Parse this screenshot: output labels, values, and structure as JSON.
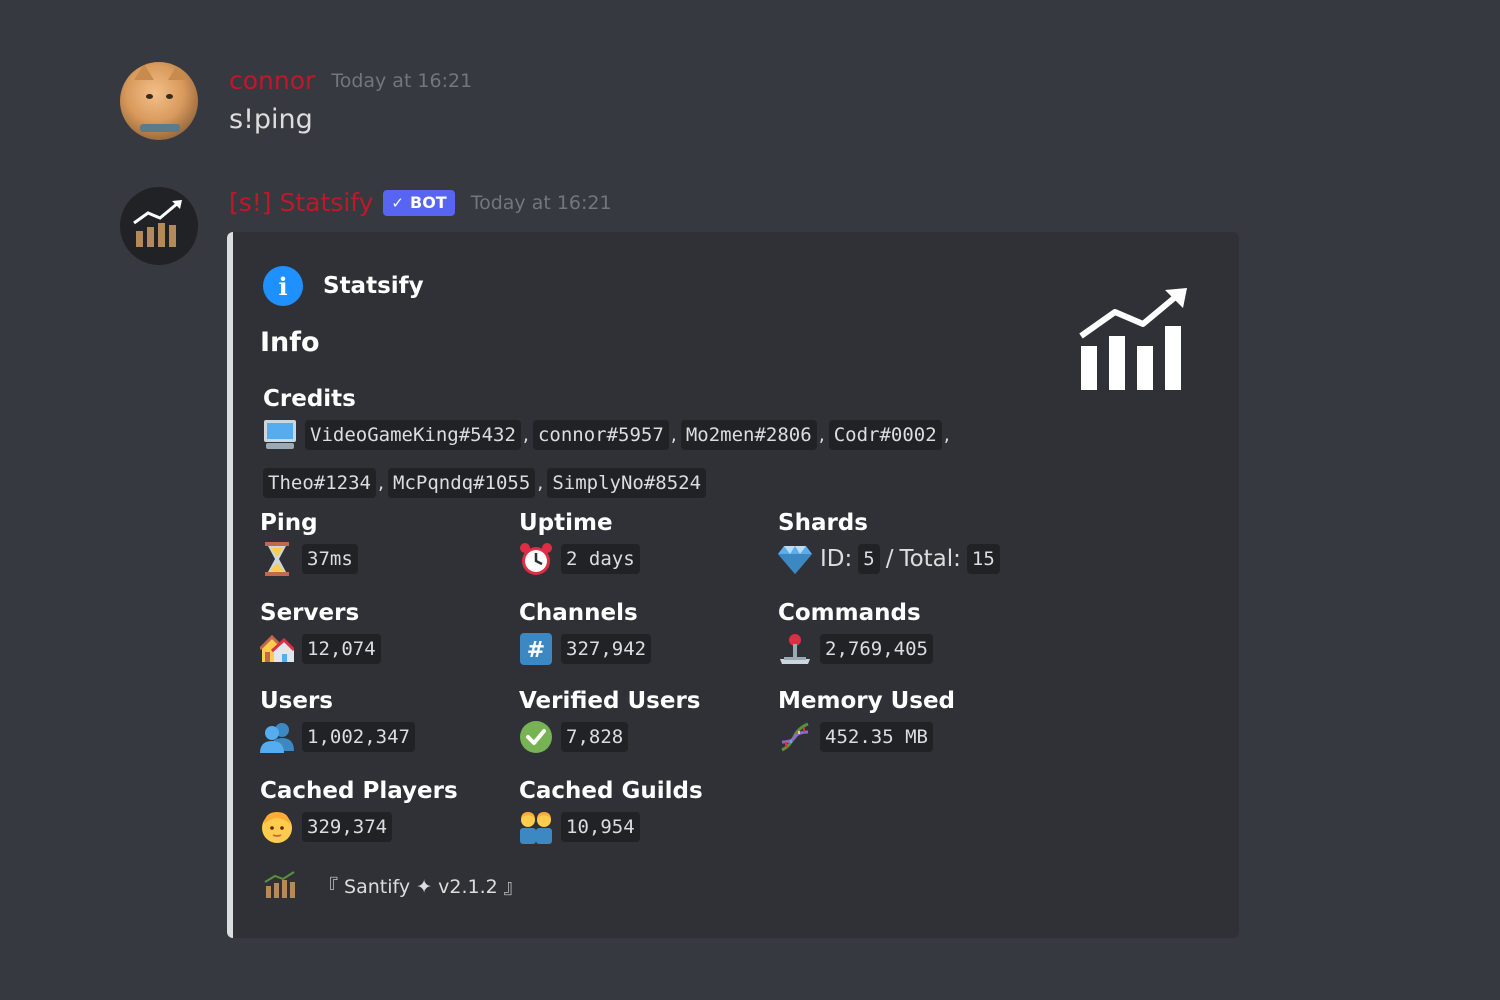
{
  "messages": [
    {
      "username": "connor",
      "timestamp": "Today at 16:21",
      "content": "s!ping"
    },
    {
      "username": "[s!] Statsify",
      "badge": "BOT",
      "timestamp": "Today at 16:21"
    }
  ],
  "embed": {
    "author": "Statsify",
    "title": "Info",
    "accent_color": "#dcddde",
    "credits": {
      "name": "Credits",
      "icon": "computer-icon",
      "users": [
        "VideoGameKing#5432",
        "connor#5957",
        "Mo2men#2806",
        "Codr#0002",
        "Theo#1234",
        "McPqndq#1055",
        "SimplyNo#8524"
      ],
      "separator": ","
    },
    "fields": {
      "ping": {
        "name": "Ping",
        "icon": "hourglass-icon",
        "value": "37ms"
      },
      "uptime": {
        "name": "Uptime",
        "icon": "alarm-clock-icon",
        "value": "2 days"
      },
      "shards": {
        "name": "Shards",
        "icon": "diamond-icon",
        "id_label": "ID:",
        "id_value": "5",
        "slash": "/",
        "total_label": "Total:",
        "total_value": "15"
      },
      "servers": {
        "name": "Servers",
        "icon": "houses-icon",
        "value": "12,074"
      },
      "channels": {
        "name": "Channels",
        "icon": "hash-icon",
        "value": "327,942"
      },
      "commands": {
        "name": "Commands",
        "icon": "joystick-icon",
        "value": "2,769,405"
      },
      "users": {
        "name": "Users",
        "icon": "users-icon",
        "value": "1,002,347"
      },
      "verified_users": {
        "name": "Verified Users",
        "icon": "check-mark-icon",
        "value": "7,828"
      },
      "memory": {
        "name": "Memory Used",
        "icon": "dna-icon",
        "value": "452.35 MB"
      },
      "cached_players": {
        "name": "Cached Players",
        "icon": "person-icon",
        "value": "329,374"
      },
      "cached_guilds": {
        "name": "Cached Guilds",
        "icon": "people-icon",
        "value": "10,954"
      }
    },
    "footer": "『 Santify ✦ v2.1.2 』"
  }
}
